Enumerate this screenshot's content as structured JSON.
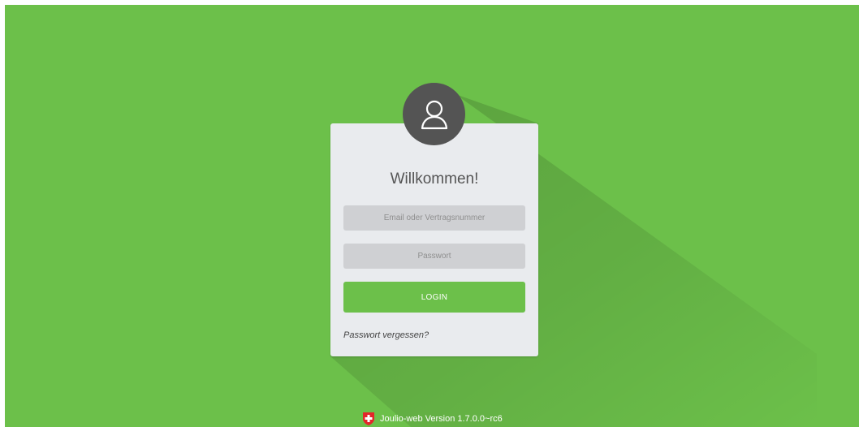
{
  "login": {
    "title": "Willkommen!",
    "email_placeholder": "Email oder Vertragsnummer",
    "password_placeholder": "Passwort",
    "login_label": "LOGIN",
    "forgot_label": "Passwort vergessen?"
  },
  "footer": {
    "version_text": "Joulio-web Version 1.7.0.0~rc6",
    "flag_icon": "swiss-cross-shield-icon"
  },
  "icons": {
    "avatar": "user-icon"
  },
  "colors": {
    "background": "#6cc04a",
    "card": "#e9ebee",
    "avatar": "#545454",
    "field": "#cfd0d3",
    "button": "#6cc04a",
    "flag_red": "#e3262a"
  }
}
